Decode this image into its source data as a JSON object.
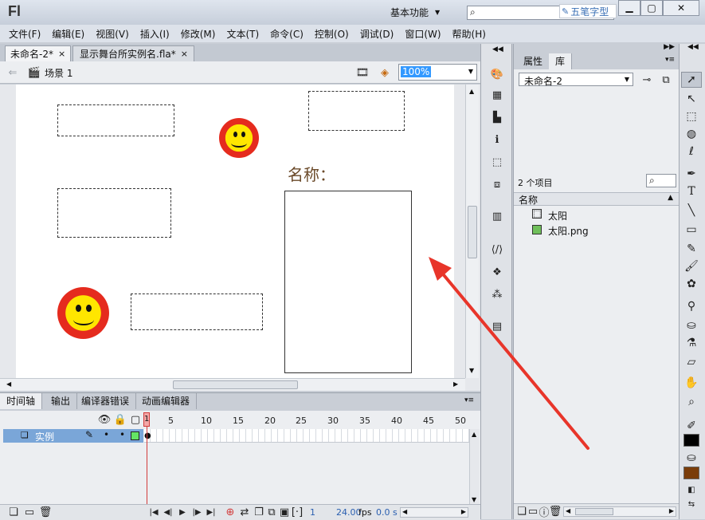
{
  "app": {
    "logo": "Fl",
    "workspace": "基本功能",
    "watermark": "五笔字型"
  },
  "menu": [
    "文件(F)",
    "编辑(E)",
    "视图(V)",
    "插入(I)",
    "修改(M)",
    "文本(T)",
    "命令(C)",
    "控制(O)",
    "调试(D)",
    "窗口(W)",
    "帮助(H)"
  ],
  "doc_tabs": [
    {
      "label": "未命名-2*",
      "close": "×"
    },
    {
      "label": "显示舞台所实例名.fla*",
      "close": "×"
    }
  ],
  "edit_bar": {
    "scene": "场景 1",
    "zoom": "100%"
  },
  "stage": {
    "name_label": "名称："
  },
  "right_panel": {
    "tabs": [
      "属性",
      "库"
    ],
    "library_doc": "未命名-2",
    "item_count": "2 个项目",
    "column_header": "名称",
    "items": [
      "太阳",
      "太阳.png"
    ]
  },
  "timeline": {
    "tabs": [
      "时间轴",
      "输出",
      "编译器错误",
      "动画编辑器"
    ],
    "layer_name": "实例",
    "frame_marker": "1",
    "ruler": [
      "5",
      "10",
      "15",
      "20",
      "25",
      "30",
      "35",
      "40",
      "45",
      "50"
    ],
    "status": {
      "frame": "1",
      "fps": "24.00",
      "fps_unit": "fps",
      "time": "0.0 s"
    }
  },
  "colors": {
    "stroke": "#000000",
    "fill": "#7a3d0a",
    "arrow": "#e8352a",
    "layer_highlight": "#7aa6d8"
  }
}
